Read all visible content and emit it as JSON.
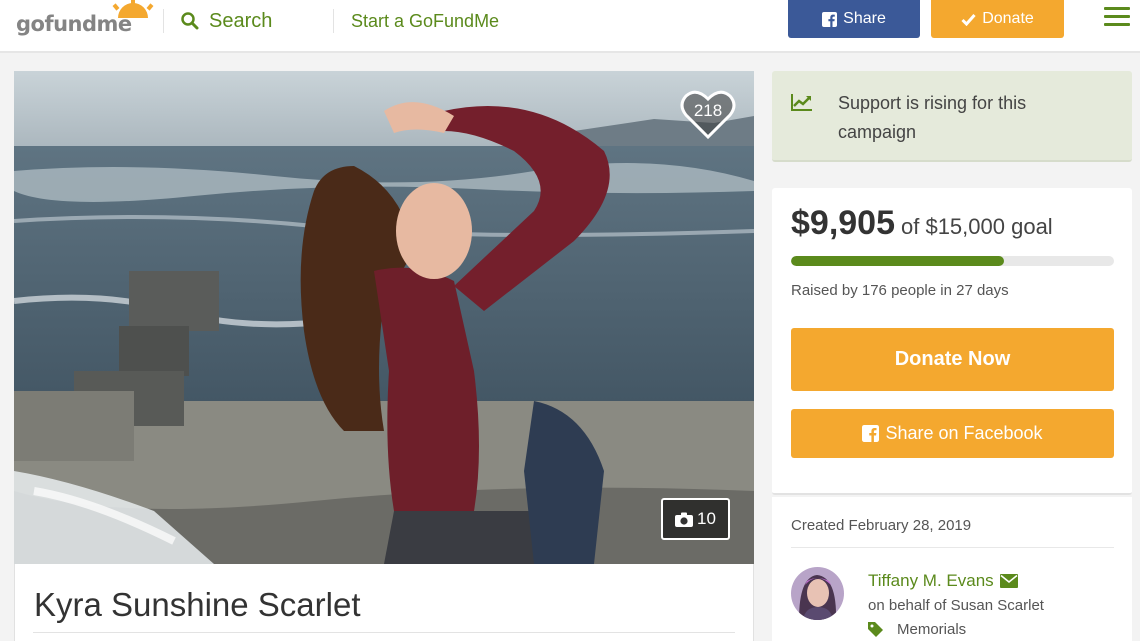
{
  "header": {
    "logo_text_a": "gofund",
    "logo_text_b": "me",
    "search_label": "Search",
    "start_label": "Start a GoFundMe",
    "share_label": "Share",
    "donate_label": "Donate"
  },
  "campaign": {
    "title": "Kyra Sunshine Scarlet",
    "heart_count": "218",
    "photo_count": "10"
  },
  "sidebar": {
    "rising_text": "Support is rising for this campaign",
    "raised_amount": "$9,905",
    "goal_text": "of $15,000 goal",
    "progress_fraction": 0.66,
    "raised_by": "Raised by 176 people in 27 days",
    "donate_now_label": "Donate Now",
    "share_facebook_label": "Share on Facebook",
    "created": "Created February 28, 2019",
    "organizer_name": "Tiffany M. Evans",
    "behalf": "on behalf of Susan Scarlet",
    "category": "Memorials"
  },
  "colors": {
    "brand_green": "#5b8a1c",
    "facebook_blue": "#3b5998",
    "donate_orange": "#f4a82f",
    "rising_bg": "#e5eadb"
  },
  "icons": [
    "search-icon",
    "facebook-icon",
    "check-icon",
    "hamburger-menu-icon",
    "heart-icon",
    "camera-icon",
    "trending-up-icon",
    "envelope-icon",
    "tag-icon"
  ]
}
